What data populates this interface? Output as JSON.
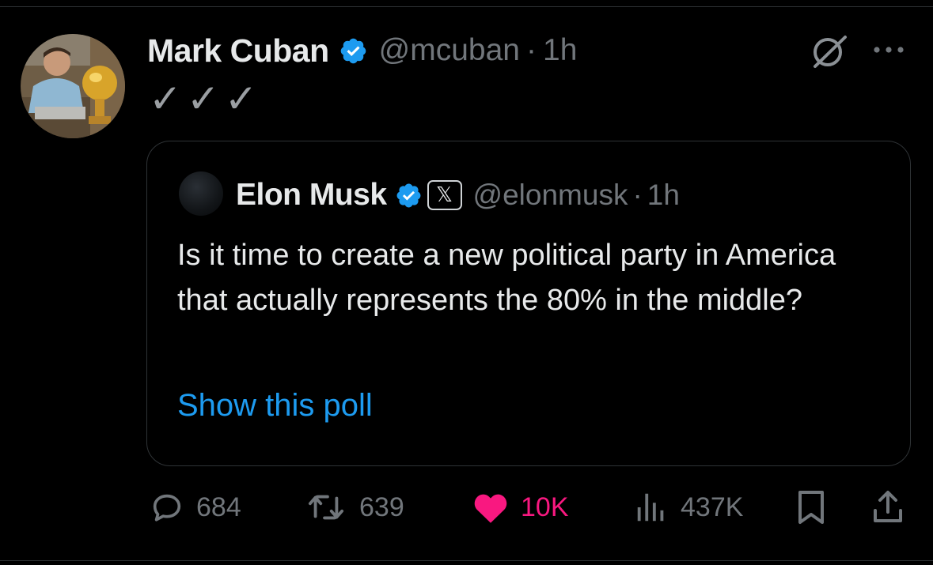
{
  "post": {
    "author_name": "Mark Cuban",
    "handle": "@mcuban",
    "separator": "·",
    "time": "1h",
    "text": "✓✓✓",
    "avatar_icon": "user-avatar-photo"
  },
  "quoted": {
    "author_name": "Elon Musk",
    "badge_text": "𝕏",
    "handle": "@elonmusk",
    "separator": "·",
    "time": "1h",
    "text": "Is it time to create a new political party in America that actually represents the 80% in the middle?",
    "poll_link": "Show this poll"
  },
  "actions": {
    "replies": "684",
    "reposts": "639",
    "likes": "10K",
    "views": "437K"
  },
  "colors": {
    "background": "#000000",
    "accent": "#1d9bf0",
    "like": "#f91880",
    "muted": "#71767b",
    "text": "#e7e9ea"
  },
  "icons": [
    "verified-badge-icon",
    "grok-icon",
    "more-icon",
    "reply-icon",
    "repost-icon",
    "like-icon",
    "views-icon",
    "bookmark-icon",
    "share-icon"
  ]
}
